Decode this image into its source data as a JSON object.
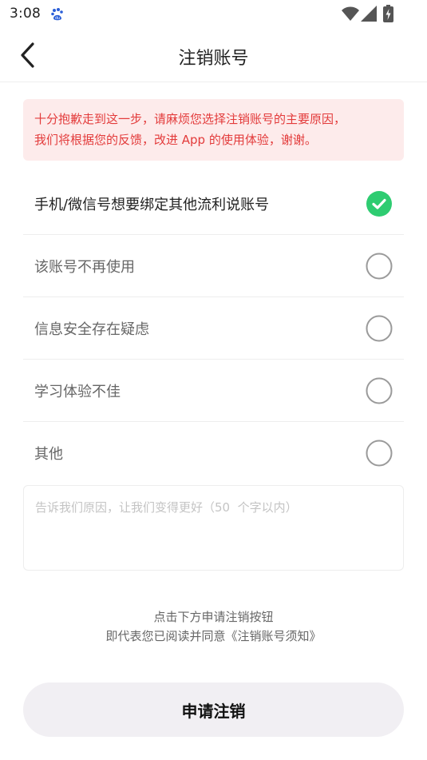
{
  "status_bar": {
    "time": "3:08",
    "app_icon": "baidu-paw-icon",
    "icons": [
      "wifi-icon",
      "signal-icon",
      "battery-charging-icon"
    ]
  },
  "header": {
    "title": "注销账号",
    "back_icon": "chevron-left-icon"
  },
  "notice": {
    "line1": "十分抱歉走到这一步，请麻烦您选择注销账号的主要原因，",
    "line2": "我们将根据您的反馈，改进 App 的使用体验，谢谢。"
  },
  "reasons": [
    {
      "label": "手机/微信号想要绑定其他流利说账号",
      "selected": true
    },
    {
      "label": "该账号不再使用",
      "selected": false
    },
    {
      "label": "信息安全存在疑虑",
      "selected": false
    },
    {
      "label": "学习体验不佳",
      "selected": false
    },
    {
      "label": "其他",
      "selected": false
    }
  ],
  "reason_input": {
    "value": "",
    "placeholder": "告诉我们原因，让我们变得更好（50  个字以内）"
  },
  "footer": {
    "line1": "点击下方申请注销按钮",
    "line2": "即代表您已阅读并同意《注销账号须知》"
  },
  "submit_label": "申请注销",
  "colors": {
    "accent_green": "#2ecc71",
    "notice_bg": "#fdebeb",
    "notice_text": "#e33b3b",
    "button_bg": "#f1eff3"
  }
}
